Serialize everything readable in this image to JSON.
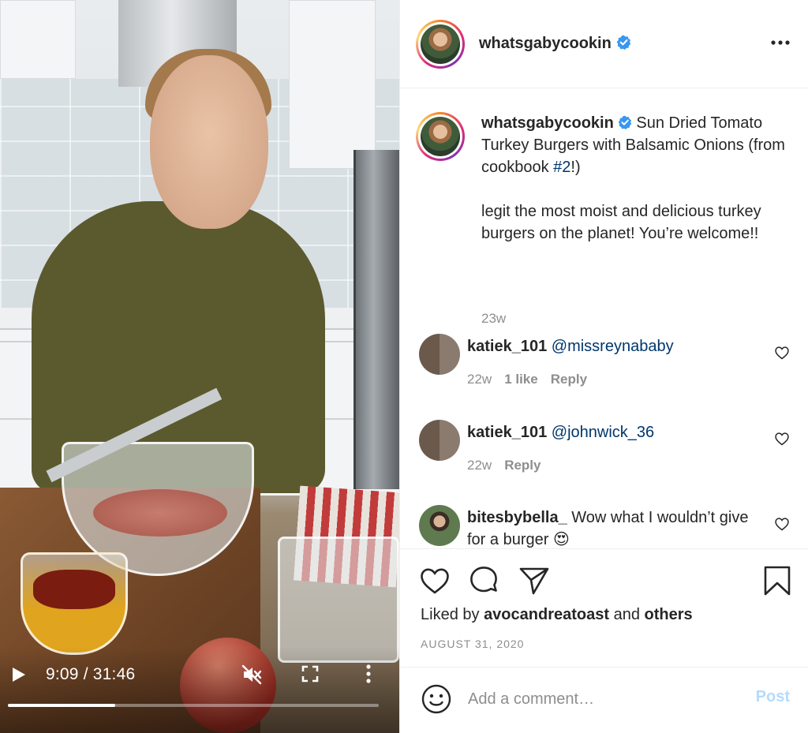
{
  "video": {
    "time_display": "9:09 / 31:46",
    "progress": 0.29
  },
  "header": {
    "username": "whatsgabycookin",
    "verified": true
  },
  "caption": {
    "username": "whatsgabycookin",
    "text_before": " Sun Dried Tomato Turkey Burgers with Balsamic Onions (from cookbook ",
    "hashtag": "#2",
    "text_after": "!)",
    "body": "legit the most moist and delicious turkey burgers on the planet! You’re welcome!!",
    "age": "23w"
  },
  "comments": [
    {
      "username": "katiek_101",
      "text": "",
      "mention": "@missreynababy",
      "age": "22w",
      "likes": "1 like",
      "reply": "Reply"
    },
    {
      "username": "katiek_101",
      "text": "",
      "mention": "@johnwick_36",
      "age": "22w",
      "likes": "",
      "reply": "Reply"
    },
    {
      "username": "bitesbybella_",
      "text": " Wow what I wouldn’t give for a burger 😍",
      "mention": "",
      "age": "",
      "likes": "",
      "reply": ""
    }
  ],
  "actions": {
    "liked_by_prefix": "Liked by ",
    "liked_by_user": "avocandreatoast",
    "liked_by_mid": " and ",
    "liked_by_others": "others",
    "date": "AUGUST 31, 2020"
  },
  "composer": {
    "placeholder": "Add a comment…",
    "post_label": "Post"
  },
  "colors": {
    "link": "#00376b",
    "verified": "#3897f0",
    "post_disabled": "#b3dbff",
    "muted": "#8e8e8e"
  }
}
